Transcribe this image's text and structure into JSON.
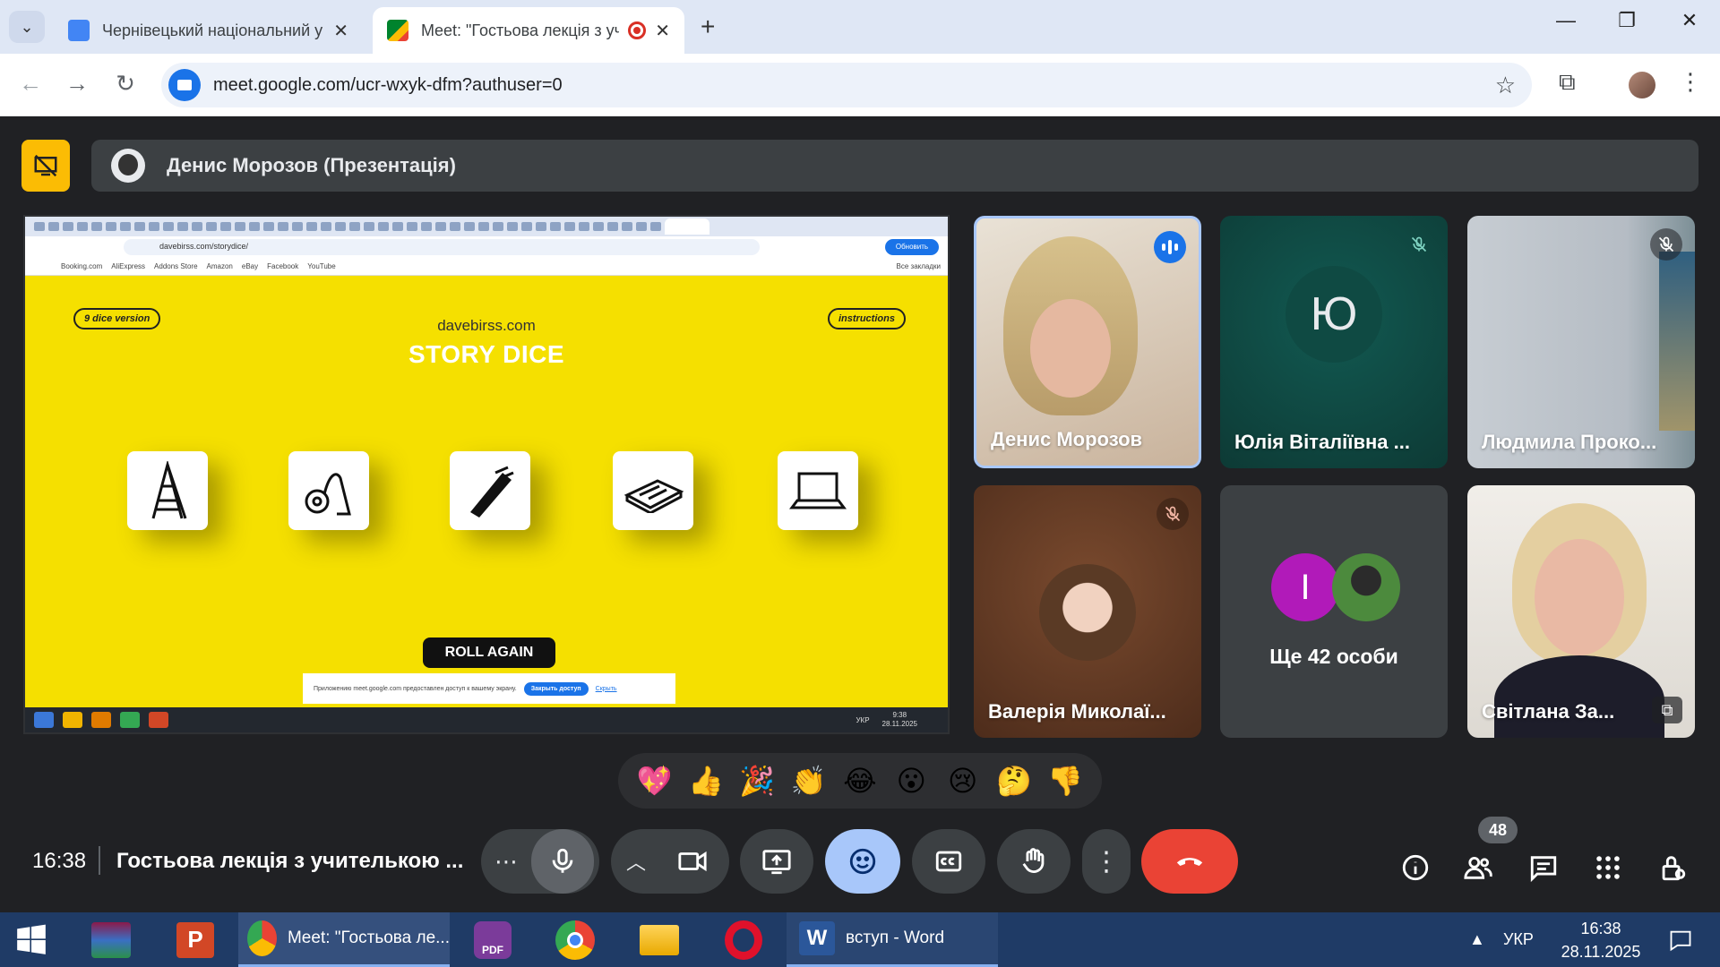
{
  "browser": {
    "tabs": [
      {
        "title": "Чернівецький національний у",
        "active": false
      },
      {
        "title": "Meet: \"Гостьова лекція з уч",
        "active": true
      }
    ],
    "url": "meet.google.com/ucr-wxyk-dfm?authuser=0"
  },
  "meet": {
    "presenter_label": "Денис Морозов (Презентація)",
    "shared_screen": {
      "url": "davebirss.com/storydice/",
      "share_button": "Обновить",
      "bookmarks": [
        "Booking.com",
        "AliExpress",
        "Addons Store",
        "Amazon",
        "eBay",
        "Facebook",
        "YouTube"
      ],
      "all_bookmarks": "Все закладки",
      "left_pill": "9 dice version",
      "right_pill": "instructions",
      "site_name": "davebirss.com",
      "title": "STORY DICE",
      "dice": [
        "ladder",
        "vacuum-cleaner",
        "comb",
        "mousetrap",
        "laptop"
      ],
      "roll_button": "ROLL AGAIN",
      "notice_text": "Приложению meet.google.com предоставлен доступ к вашему экрану.",
      "notice_button": "Закрыть доступ",
      "notice_hide": "Скрыть",
      "tray_lang": "УКР",
      "tray_time": "9:38",
      "tray_date": "28.11.2025"
    },
    "participants": [
      {
        "name": "Денис Морозов",
        "state": "speaking"
      },
      {
        "name": "Юлія Віталіївна ...",
        "initial": "Ю",
        "state": "muted"
      },
      {
        "name": "Людмила Проко...",
        "state": "muted"
      },
      {
        "name": "Валерія Миколаї...",
        "state": "muted"
      },
      {
        "name": "Ще 42 особи",
        "initial": "І"
      },
      {
        "name": "Світлана За..."
      }
    ],
    "reactions": [
      "💖",
      "👍",
      "🎉",
      "👏",
      "😂",
      "😮",
      "😢",
      "🤔",
      "👎"
    ],
    "time": "16:38",
    "meeting_title": "Гостьова лекція з учителькою ...",
    "people_count": "48"
  },
  "taskbar": {
    "meet_label": "Meet: \"Гостьова ле...",
    "word_label": "вступ - Word",
    "lang": "УКР",
    "time": "16:38",
    "date": "28.11.2025"
  },
  "colors": {
    "accent": "#1a73e8",
    "presenting": "#fbbc04",
    "end_call": "#ea4335",
    "story_dice_bg": "#f5e000"
  }
}
